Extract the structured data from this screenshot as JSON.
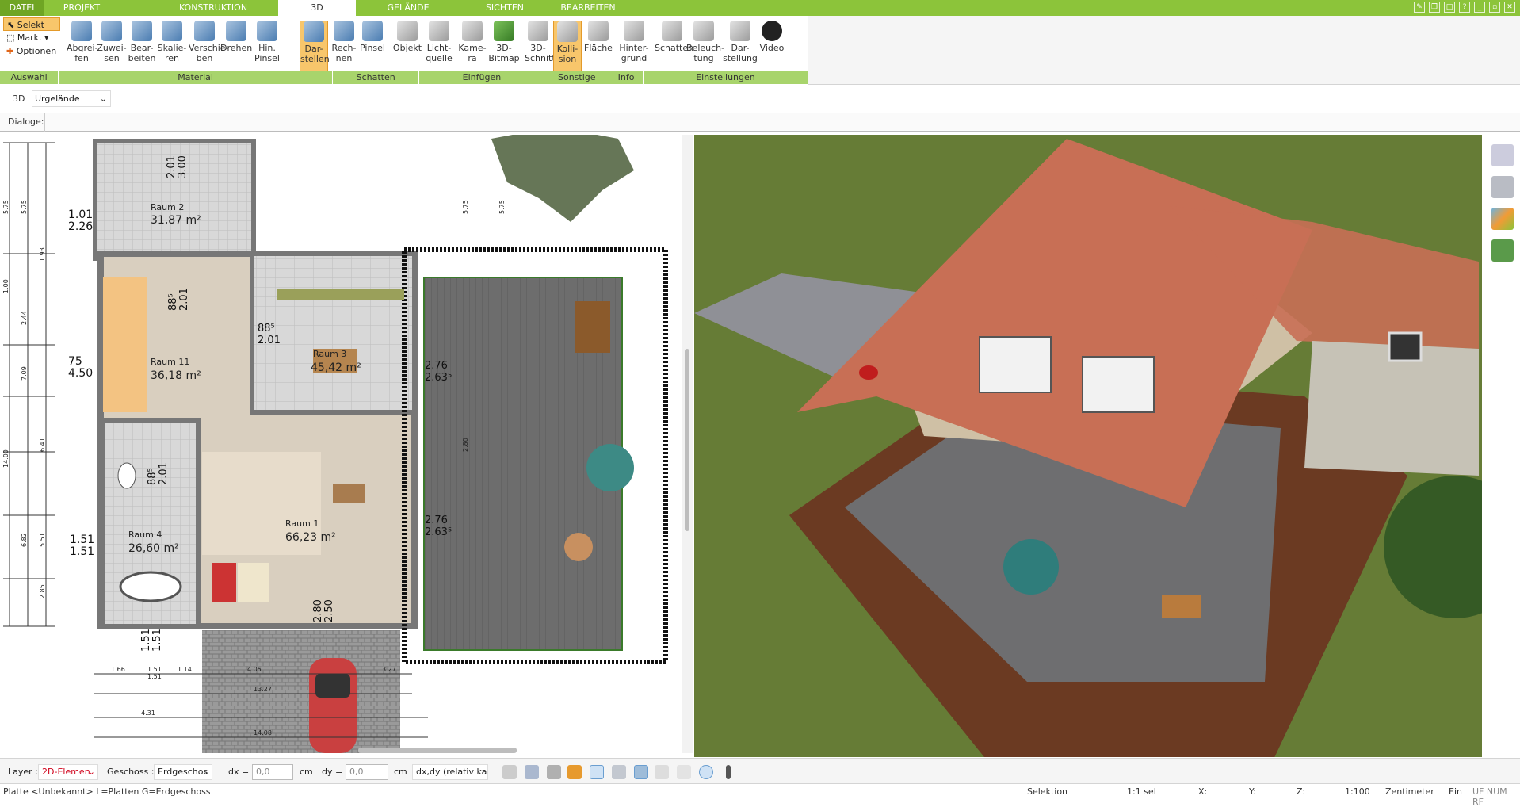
{
  "menu": {
    "tabs": [
      "DATEI",
      "PROJEKT",
      "KONSTRUKTION",
      "3D",
      "GELÄNDE",
      "SICHTEN",
      "BEARBEITEN"
    ],
    "active": "3D"
  },
  "ribbon": {
    "left": {
      "select": "Selekt",
      "mark": "Mark.",
      "options": "Optionen"
    },
    "buttons": [
      {
        "label": "Abgrei-\nfen",
        "icon": "eyedropper-icon"
      },
      {
        "label": "Zuwei-\nsen",
        "icon": "assign-material-icon"
      },
      {
        "label": "Bear-\nbeiten",
        "icon": "edit-material-icon"
      },
      {
        "label": "Skalie-\nren",
        "icon": "scale-icon"
      },
      {
        "label": "Verschie-\nben",
        "icon": "move-icon"
      },
      {
        "label": "Drehen",
        "icon": "rotate-icon"
      },
      {
        "label": "Hin.\nPinsel",
        "icon": "background-brush-icon"
      },
      {
        "label": "Dar-\nstellen",
        "icon": "shadow-display-icon"
      },
      {
        "label": "Rech-\nnen",
        "icon": "shadow-calc-icon"
      },
      {
        "label": "Pinsel",
        "icon": "shadow-brush-icon"
      },
      {
        "label": "Objekt",
        "icon": "chair-icon"
      },
      {
        "label": "Licht-\nquelle",
        "icon": "lightbulb-icon"
      },
      {
        "label": "Kame-\nra",
        "icon": "camera-icon"
      },
      {
        "label": "3D-\nBitmap",
        "icon": "tree-icon"
      },
      {
        "label": "3D-\nSchnitt",
        "icon": "section-icon"
      },
      {
        "label": "Kolli-\nsion",
        "icon": "collision-icon"
      },
      {
        "label": "Fläche",
        "icon": "area-info-icon"
      },
      {
        "label": "Hinter-\ngrund",
        "icon": "background-icon"
      },
      {
        "label": "Schatten",
        "icon": "house-shadow-icon"
      },
      {
        "label": "Beleuch-\ntung",
        "icon": "lighting-icon"
      },
      {
        "label": "Dar-\nstellung",
        "icon": "monitor-icon"
      },
      {
        "label": "Video",
        "icon": "play-icon"
      }
    ],
    "groups": [
      "Auswahl",
      "Material",
      "Schatten",
      "Einfügen",
      "Sonstige",
      "Info",
      "Einstellungen"
    ]
  },
  "viewbar": {
    "mode": "3D",
    "terrain": "Urgelände"
  },
  "dialogs": {
    "label": "Dialoge:"
  },
  "plan": {
    "rooms": [
      {
        "name": "Raum 2",
        "area": "31,87 m²"
      },
      {
        "name": "Raum 11",
        "area": "36,18 m²"
      },
      {
        "name": "Raum 3",
        "area": "45,42 m²"
      },
      {
        "name": "Raum 4",
        "area": "26,60 m²"
      },
      {
        "name": "Raum 1",
        "area": "66,23 m²"
      }
    ],
    "dims": [
      "2.01",
      "3.00",
      "1.01",
      "2.26",
      "75",
      "4.50",
      "88⁵",
      "2.01",
      "88⁵",
      "2.01",
      "2.76",
      "2.63⁵",
      "88⁵",
      "2.01",
      "2.76",
      "2.63⁵",
      "1.51",
      "1.51",
      "2.80",
      "2.50",
      "1.51",
      "1.51"
    ],
    "small_dims": [
      "1.66",
      "1.51",
      "1.14",
      "1.51",
      "4.05",
      "3.27",
      "13.27",
      "4.31",
      "14.08",
      "5.75",
      "5.75",
      "1.93",
      "1.00",
      "2.44",
      "7.09",
      "6.41",
      "14.00",
      "6.82",
      "5.51",
      "2.85",
      "2.80",
      "5.75",
      "5.75"
    ]
  },
  "toolbar": {
    "layer_label": "Layer :",
    "layer_value": "2D-Elemen",
    "floor_label": "Geschoss :",
    "floor_value": "Erdgeschos",
    "dx_label": "dx =",
    "dx_value": "0,0",
    "dx_unit": "cm",
    "dy_label": "dy =",
    "dy_value": "0,0",
    "dy_unit": "cm",
    "mode_value": "dx,dy (relativ ka"
  },
  "status": {
    "hint": "Platte <Unbekannt> L=Platten G=Erdgeschoss",
    "mode": "Selektion",
    "sel": "1:1 sel",
    "x": "X:",
    "y": "Y:",
    "z": "Z:",
    "scale": "1:100",
    "unit": "Zentimeter",
    "ein": "Ein",
    "flags": "UF NUM RF"
  },
  "colors": {
    "accent": "#8cc43a",
    "group": "#a8d46c",
    "selected": "#f8c66b",
    "layer": "#d0021b"
  }
}
